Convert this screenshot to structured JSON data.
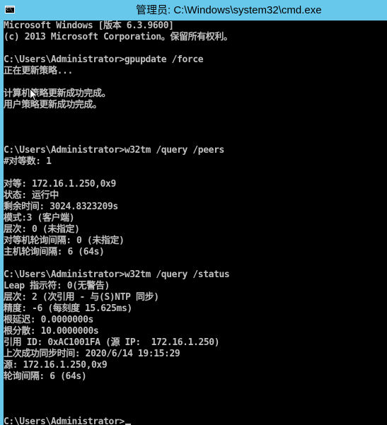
{
  "window": {
    "title": "管理员: C:\\Windows\\system32\\cmd.exe",
    "icon": "cmd-icon",
    "icon_text": "C:\\_",
    "titlebar_color": "#67c8ec"
  },
  "console": {
    "background": "#000000",
    "foreground": "#c0c0c0",
    "lines": [
      "Microsoft Windows [版本 6.3.9600]",
      "(c) 2013 Microsoft Corporation。保留所有权利。",
      "",
      "C:\\Users\\Administrator>gpupdate /force",
      "正在更新策略...",
      "",
      "计算机策略更新成功完成。",
      "用户策略更新成功完成。",
      "",
      "",
      "",
      "C:\\Users\\Administrator>w32tm /query /peers",
      "#对等数: 1",
      "",
      "对等: 172.16.1.250,0x9",
      "状态: 运行中",
      "剩余时间: 3024.8323209s",
      "模式:3 (客户端)",
      "层次: 0 (未指定)",
      "对等机轮询间隔: 0 (未指定)",
      "主机轮询间隔: 6 (64s)",
      "",
      "C:\\Users\\Administrator>w32tm /query /status",
      "Leap 指示符: 0(无警告)",
      "层次: 2 (次引用 - 与(S)NTP 同步)",
      "精度: -6 (每刻度 15.625ms)",
      "根延迟: 0.0000000s",
      "根分散: 10.0000000s",
      "引用 ID: 0xAC1001FA (源 IP:  172.16.1.250)",
      "上次成功同步时间: 2020/6/14 19:15:29",
      "源: 172.16.1.250,0x9",
      "轮询间隔: 6 (64s)",
      "",
      "",
      "",
      "C:\\Users\\Administrator>"
    ],
    "cursor_visible": true
  }
}
